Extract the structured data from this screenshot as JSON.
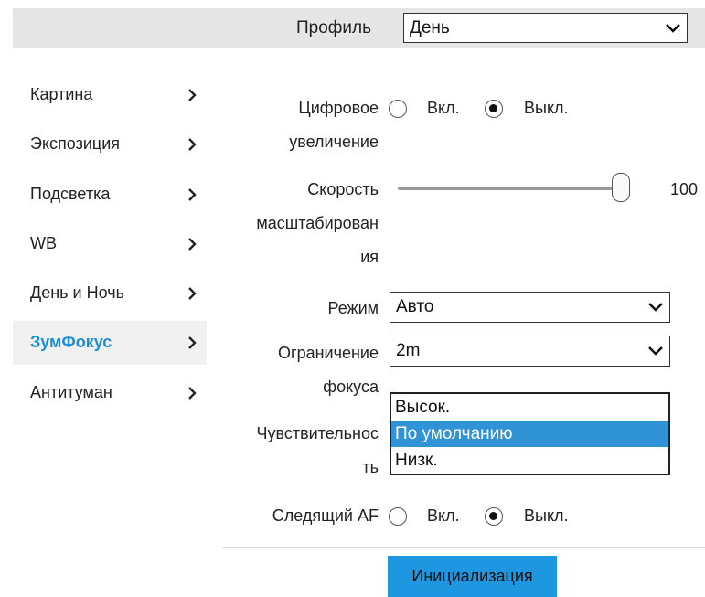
{
  "header": {
    "profile_label": "Профиль",
    "profile_value": "День"
  },
  "sidebar": {
    "items": [
      {
        "label": "Картина"
      },
      {
        "label": "Экспозиция"
      },
      {
        "label": "Подсветка"
      },
      {
        "label": "WB"
      },
      {
        "label": "День и Ночь"
      },
      {
        "label": "ЗумФокус",
        "active": true
      },
      {
        "label": "Антитуман"
      }
    ]
  },
  "form": {
    "digital_zoom": {
      "label_line1": "Цифровое",
      "label_line2": "увеличение",
      "option_on": "Вкл.",
      "option_off": "Выкл.",
      "selected": "Выкл."
    },
    "zoom_speed": {
      "label_line1": "Скорость",
      "label_line2": "масштабирован",
      "label_line3": "ия",
      "value": "100"
    },
    "mode": {
      "label": "Режим",
      "value": "Авто"
    },
    "focus_limit": {
      "label_line1": "Ограничение",
      "label_line2": "фокуса",
      "value": "2m"
    },
    "sensitivity": {
      "label_line1": "Чувствительнос",
      "label_line2": "ть",
      "options": [
        "Высок.",
        "По умолчанию",
        "Низк."
      ],
      "highlighted": "По умолчанию"
    },
    "tracking_af": {
      "label": "Следящий AF",
      "option_on": "Вкл.",
      "option_off": "Выкл.",
      "selected": "Выкл."
    },
    "init_button": "Инициализация"
  },
  "colors": {
    "accent": "#1a8fd8",
    "button": "#1e96e0",
    "highlight": "#2f93d6",
    "topbar": "#e6e6e6"
  }
}
